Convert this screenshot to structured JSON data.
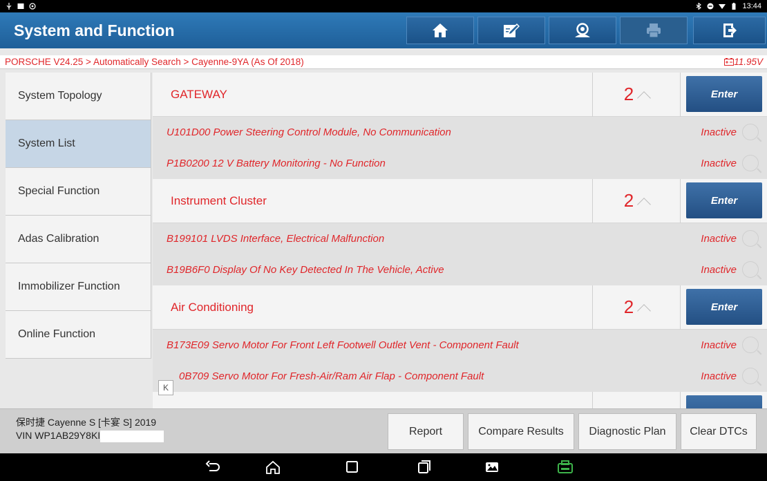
{
  "status_bar": {
    "time": "13:44"
  },
  "header": {
    "title": "System and Function",
    "buttons": [
      "home-icon",
      "edit-icon",
      "user-icon",
      "printer-icon",
      "exit-icon"
    ]
  },
  "breadcrumb": {
    "path": "PORSCHE V24.25 > Automatically Search > Cayenne-9YA (As Of 2018)",
    "voltage": "11.95V"
  },
  "sidebar": {
    "items": [
      {
        "label": "System Topology"
      },
      {
        "label": "System List"
      },
      {
        "label": "Special Function"
      },
      {
        "label": "Adas Calibration"
      },
      {
        "label": "Immobilizer Function"
      },
      {
        "label": "Online Function"
      }
    ],
    "active_index": 1
  },
  "systems": [
    {
      "name": "GATEWAY",
      "count": "2",
      "enter_label": "Enter",
      "dtcs": [
        {
          "text": "U101D00 Power Steering Control Module, No Communication",
          "status": "Inactive"
        },
        {
          "text": "P1B0200 12 V Battery Monitoring - No Function",
          "status": "Inactive"
        }
      ]
    },
    {
      "name": "Instrument Cluster",
      "count": "2",
      "enter_label": "Enter",
      "dtcs": [
        {
          "text": "B199101 LVDS Interface, Electrical Malfunction",
          "status": "Inactive"
        },
        {
          "text": "B19B6F0 Display Of No Key Detected In The Vehicle, Active",
          "status": "Inactive"
        }
      ]
    },
    {
      "name": "Air Conditioning",
      "count": "2",
      "enter_label": "Enter",
      "dtcs": [
        {
          "text": "B173E09 Servo Motor For Front Left Footwell Outlet Vent - Component Fault",
          "status": "Inactive"
        },
        {
          "text": "0B709 Servo Motor For Fresh-Air/Ram Air Flap - Component Fault",
          "status": "Inactive"
        }
      ]
    }
  ],
  "collapse_glyph": "K",
  "vehicle": {
    "model": "保时捷 Cayenne S [卡宴 S] 2019",
    "vin": "VIN WP1AB29Y8KI"
  },
  "actions": {
    "report": "Report",
    "compare": "Compare Results",
    "plan": "Diagnostic Plan",
    "clear": "Clear DTCs"
  },
  "colors": {
    "accent_red": "#e0262a",
    "header_blue": "#1e5f99",
    "enter_blue": "#2f5f96"
  }
}
